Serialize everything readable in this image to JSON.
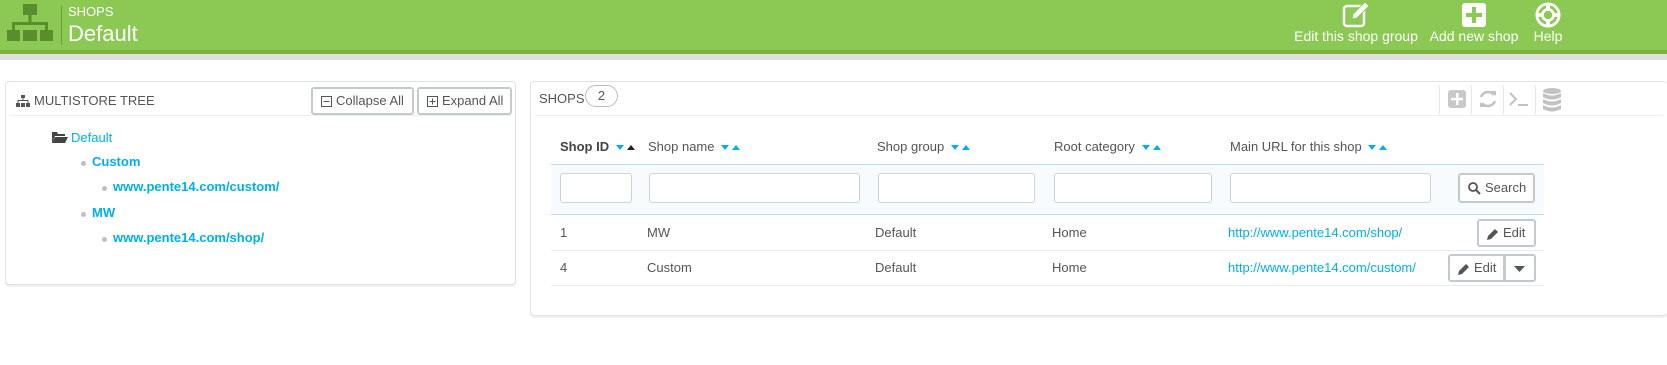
{
  "header": {
    "breadcrumb": "SHOPS",
    "title": "Default",
    "color": "#8bc954",
    "actions": [
      {
        "label": "Edit this shop group",
        "icon": "edit-icon"
      },
      {
        "label": "Add new shop",
        "icon": "plus-icon"
      },
      {
        "label": "Help",
        "icon": "lifebuoy-icon"
      }
    ]
  },
  "tree_panel": {
    "title": "MULTISTORE TREE",
    "collapse_label": "Collapse All",
    "expand_label": "Expand All",
    "root": "Default",
    "shops": [
      {
        "name": "Custom",
        "url": "www.pente14.com/custom/"
      },
      {
        "name": "MW",
        "url": "www.pente14.com/shop/"
      }
    ]
  },
  "shops_panel": {
    "title": "SHOPS",
    "count": "2",
    "columns": [
      "Shop ID",
      "Shop name",
      "Shop group",
      "Root category",
      "Main URL for this shop"
    ],
    "search_label": "Search",
    "rows": [
      {
        "id": "1",
        "name": "MW",
        "group": "Default",
        "category": "Home",
        "url": "http://www.pente14.com/shop/",
        "action": "Edit"
      },
      {
        "id": "4",
        "name": "Custom",
        "group": "Default",
        "category": "Home",
        "url": "http://www.pente14.com/custom/",
        "action": "Edit"
      }
    ]
  },
  "colors": {
    "accent": "#00aff0",
    "header": "#8bc954"
  }
}
